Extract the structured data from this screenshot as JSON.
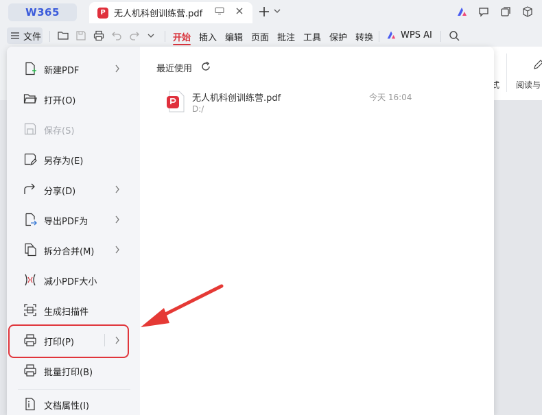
{
  "app": {
    "logo_text": "W365"
  },
  "tab": {
    "title": "无人机科创训练营.pdf",
    "badge": "P"
  },
  "toolbar": {
    "file_label": "文件",
    "ribbon_tabs": [
      "开始",
      "插入",
      "编辑",
      "页面",
      "批注",
      "工具",
      "保护",
      "转换"
    ],
    "active_tab": "开始",
    "wps_ai_label": "WPS AI"
  },
  "ribbon_panel": {
    "partial_text": "式",
    "read_text": "阅读与"
  },
  "file_menu": {
    "items": [
      {
        "label": "新建PDF",
        "icon": "new-pdf-icon",
        "submenu": true
      },
      {
        "label": "打开(O)",
        "icon": "folder-open-icon",
        "submenu": false
      },
      {
        "label": "保存(S)",
        "icon": "save-icon",
        "submenu": false,
        "disabled": true
      },
      {
        "label": "另存为(E)",
        "icon": "save-as-icon",
        "submenu": false
      },
      {
        "label": "分享(D)",
        "icon": "share-icon",
        "submenu": true
      },
      {
        "label": "导出PDF为",
        "icon": "export-icon",
        "submenu": true
      },
      {
        "label": "拆分合并(M)",
        "icon": "split-merge-icon",
        "submenu": true
      },
      {
        "label": "减小PDF大小",
        "icon": "compress-icon",
        "submenu": false
      },
      {
        "label": "生成扫描件",
        "icon": "scan-icon",
        "submenu": false
      },
      {
        "label": "打印(P)",
        "icon": "print-icon",
        "submenu": true,
        "highlighted": true
      },
      {
        "label": "批量打印(B)",
        "icon": "batch-print-icon",
        "submenu": false
      },
      {
        "label": "文档属性(I)",
        "icon": "doc-properties-icon",
        "submenu": false
      }
    ]
  },
  "recent": {
    "title": "最近使用",
    "files": [
      {
        "name": "无人机科创训练营.pdf",
        "path": "D:/",
        "time": "今天 16:04"
      }
    ]
  },
  "colors": {
    "accent": "#d9363e",
    "highlight_border": "#e0353b",
    "logo_blue": "#3b5bdb"
  }
}
